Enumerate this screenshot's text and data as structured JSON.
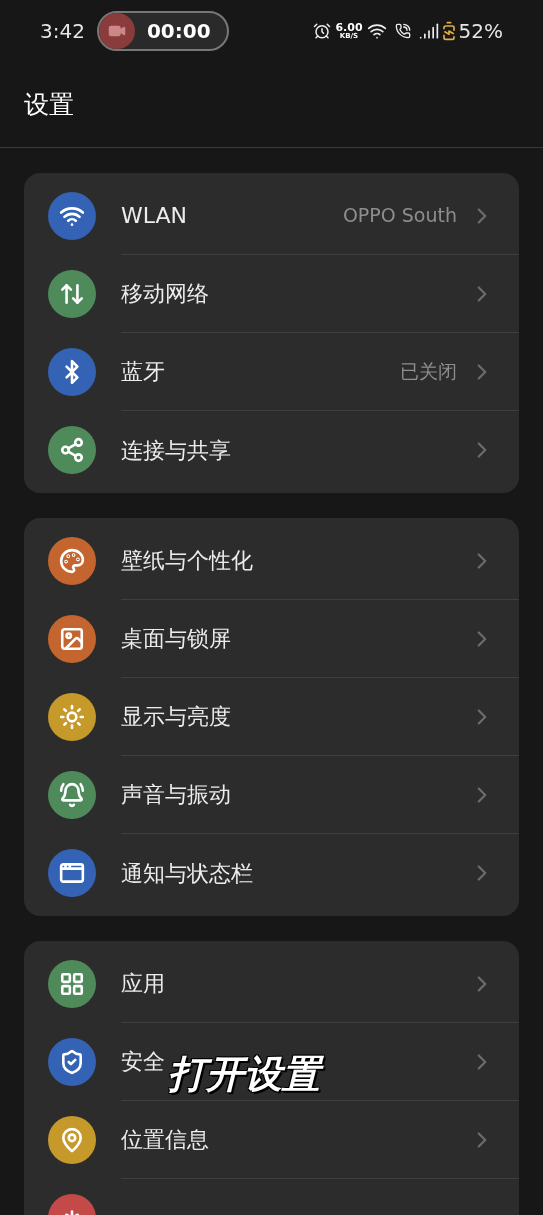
{
  "status_bar": {
    "time": "3:42",
    "recording": {
      "timer": "00:00"
    },
    "net_speed": "6.00",
    "net_unit": "KB/S",
    "battery": "52%"
  },
  "title": "设置",
  "groups": [
    {
      "items": [
        {
          "kind": "wifi",
          "color": "#3462b4",
          "label": "WLAN",
          "value": "OPPO South"
        },
        {
          "kind": "data",
          "color": "#4f8a5b",
          "label": "移动网络"
        },
        {
          "kind": "bluetooth",
          "color": "#3462b4",
          "label": "蓝牙",
          "value": "已关闭"
        },
        {
          "kind": "share",
          "color": "#4f8a5b",
          "label": "连接与共享"
        }
      ]
    },
    {
      "items": [
        {
          "kind": "palette",
          "color": "#c4652f",
          "label": "壁纸与个性化"
        },
        {
          "kind": "image",
          "color": "#c4652f",
          "label": "桌面与锁屏"
        },
        {
          "kind": "sun",
          "color": "#c59a2b",
          "label": "显示与亮度"
        },
        {
          "kind": "bell",
          "color": "#4f8a5b",
          "label": "声音与振动"
        },
        {
          "kind": "notice",
          "color": "#3462b4",
          "label": "通知与状态栏"
        }
      ]
    },
    {
      "items": [
        {
          "kind": "apps",
          "color": "#4f8a5b",
          "label": "应用"
        },
        {
          "kind": "shield",
          "color": "#3462b4",
          "label": "安全"
        },
        {
          "kind": "pin",
          "color": "#c59a2b",
          "label": "位置信息"
        },
        {
          "kind": "sos",
          "color": "#c44a4a"
        }
      ]
    }
  ],
  "caption": "打开设置"
}
